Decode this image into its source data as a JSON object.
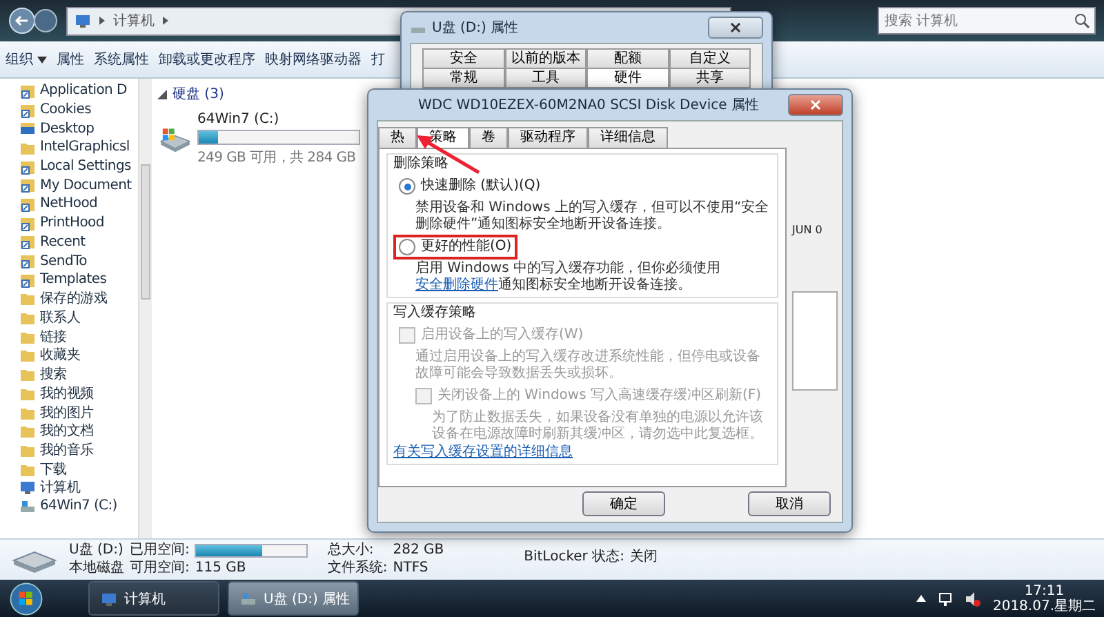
{
  "explorer": {
    "address": [
      "计算机"
    ],
    "search": {
      "placeholder": "搜索 计算机"
    },
    "toolbar": [
      {
        "label": "组织",
        "dropdown": true
      },
      {
        "label": "属性",
        "dropdown": false
      },
      {
        "label": "系统属性",
        "dropdown": false
      },
      {
        "label": "卸载或更改程序",
        "dropdown": false
      },
      {
        "label": "映射网络驱动器",
        "dropdown": false
      },
      {
        "label": "打",
        "dropdown": false
      }
    ],
    "nav": [
      {
        "label": "Application D",
        "kind": "shortcut"
      },
      {
        "label": "Cookies",
        "kind": "shortcut"
      },
      {
        "label": "Desktop",
        "kind": "desktop"
      },
      {
        "label": "IntelGraphicsl",
        "kind": "folder"
      },
      {
        "label": "Local Settings",
        "kind": "shortcut"
      },
      {
        "label": "My Document",
        "kind": "shortcut"
      },
      {
        "label": "NetHood",
        "kind": "shortcut"
      },
      {
        "label": "PrintHood",
        "kind": "shortcut"
      },
      {
        "label": "Recent",
        "kind": "shortcut"
      },
      {
        "label": "SendTo",
        "kind": "shortcut"
      },
      {
        "label": "Templates",
        "kind": "shortcut"
      },
      {
        "label": "保存的游戏",
        "kind": "folder"
      },
      {
        "label": "联系人",
        "kind": "folder"
      },
      {
        "label": "链接",
        "kind": "folder"
      },
      {
        "label": "收藏夹",
        "kind": "folder"
      },
      {
        "label": "搜索",
        "kind": "folder"
      },
      {
        "label": "我的视频",
        "kind": "folder"
      },
      {
        "label": "我的图片",
        "kind": "folder"
      },
      {
        "label": "我的文档",
        "kind": "folder"
      },
      {
        "label": "我的音乐",
        "kind": "folder"
      },
      {
        "label": "下载",
        "kind": "folder"
      },
      {
        "label": "计算机",
        "kind": "computer"
      },
      {
        "label": "64Win7 (C:)",
        "kind": "drive"
      }
    ],
    "group": {
      "title": "硬盘 (3)",
      "expanded": true
    },
    "drives": [
      {
        "name": "64Win7 (C:)",
        "level": 0.12,
        "info": "249 GB 可用，共 284 GB"
      }
    ],
    "details": {
      "name": "U盘 (D:)",
      "type": "本地磁盘",
      "used_label": "已用空间:",
      "level": 0.59,
      "free_label": "可用空间:",
      "free": "115 GB",
      "total_label": "总大小:",
      "total": "282 GB",
      "fs_label": "文件系统:",
      "fs": "NTFS",
      "bitlocker_label": "BitLocker 状态:",
      "bitlocker": "关闭"
    }
  },
  "back_dialog": {
    "title": "U盘 (D:) 属性",
    "tab_rows": [
      [
        {
          "label": "安全",
          "selected": false
        },
        {
          "label": "以前的版本",
          "selected": false
        },
        {
          "label": "配额",
          "selected": false
        },
        {
          "label": "自定义",
          "selected": false
        }
      ],
      [
        {
          "label": "常规",
          "selected": false
        },
        {
          "label": "工具",
          "selected": false
        },
        {
          "label": "硬件",
          "selected": true
        },
        {
          "label": "共享",
          "selected": false
        }
      ]
    ]
  },
  "front_dialog": {
    "title": "WDC WD10EZEX-60M2NA0 SCSI Disk Device 属性",
    "tabs": [
      {
        "label": "热",
        "selected": false
      },
      {
        "label": "策略",
        "selected": true
      },
      {
        "label": "卷",
        "selected": false
      },
      {
        "label": "驱动程序",
        "selected": false
      },
      {
        "label": "详细信息",
        "selected": false
      }
    ],
    "removal": {
      "title": "删除策略",
      "options": [
        {
          "label": "快速删除 (默认)(Q)",
          "selected": true,
          "highlighted": false,
          "description": "禁用设备和 Windows 上的写入缓存，但可以不使用“安全删除硬件”通知图标安全地断开设备连接。"
        },
        {
          "label": "更好的性能(O)",
          "selected": false,
          "highlighted": true,
          "description": "启用 Windows 中的写入缓存功能，但你必须使用",
          "link": "安全删除硬件",
          "description_end": "通知图标安全地断开设备连接。"
        }
      ]
    },
    "cache": {
      "title": "写入缓存策略",
      "options": [
        {
          "label": "启用设备上的写入缓存(W)",
          "checked": false,
          "disabled": true,
          "description": "通过启用设备上的写入缓存改进系统性能，但停电或设备故障可能会导致数据丢失或损坏。",
          "children": [
            {
              "label": "关闭设备上的 Windows 写入高速缓存缓冲区刷新(F)",
              "checked": false,
              "disabled": true,
              "description": "为了防止数据丢失，如果设备没有单独的电源以允许该设备在电源故障时刷新其缓冲区，请勿选中此复选框。"
            }
          ]
        }
      ]
    },
    "more_link": "有关写入缓存设置的详细信息",
    "side_text": "JUN 0",
    "buttons": [
      "确定",
      "取消"
    ]
  },
  "taskbar": {
    "tasks": [
      {
        "label": "计算机",
        "selected": false,
        "kind": "computer"
      },
      {
        "label": "U盘 (D:) 属性",
        "selected": true,
        "kind": "drive"
      }
    ],
    "time": "17:11",
    "date": "2018.07.星期二"
  }
}
